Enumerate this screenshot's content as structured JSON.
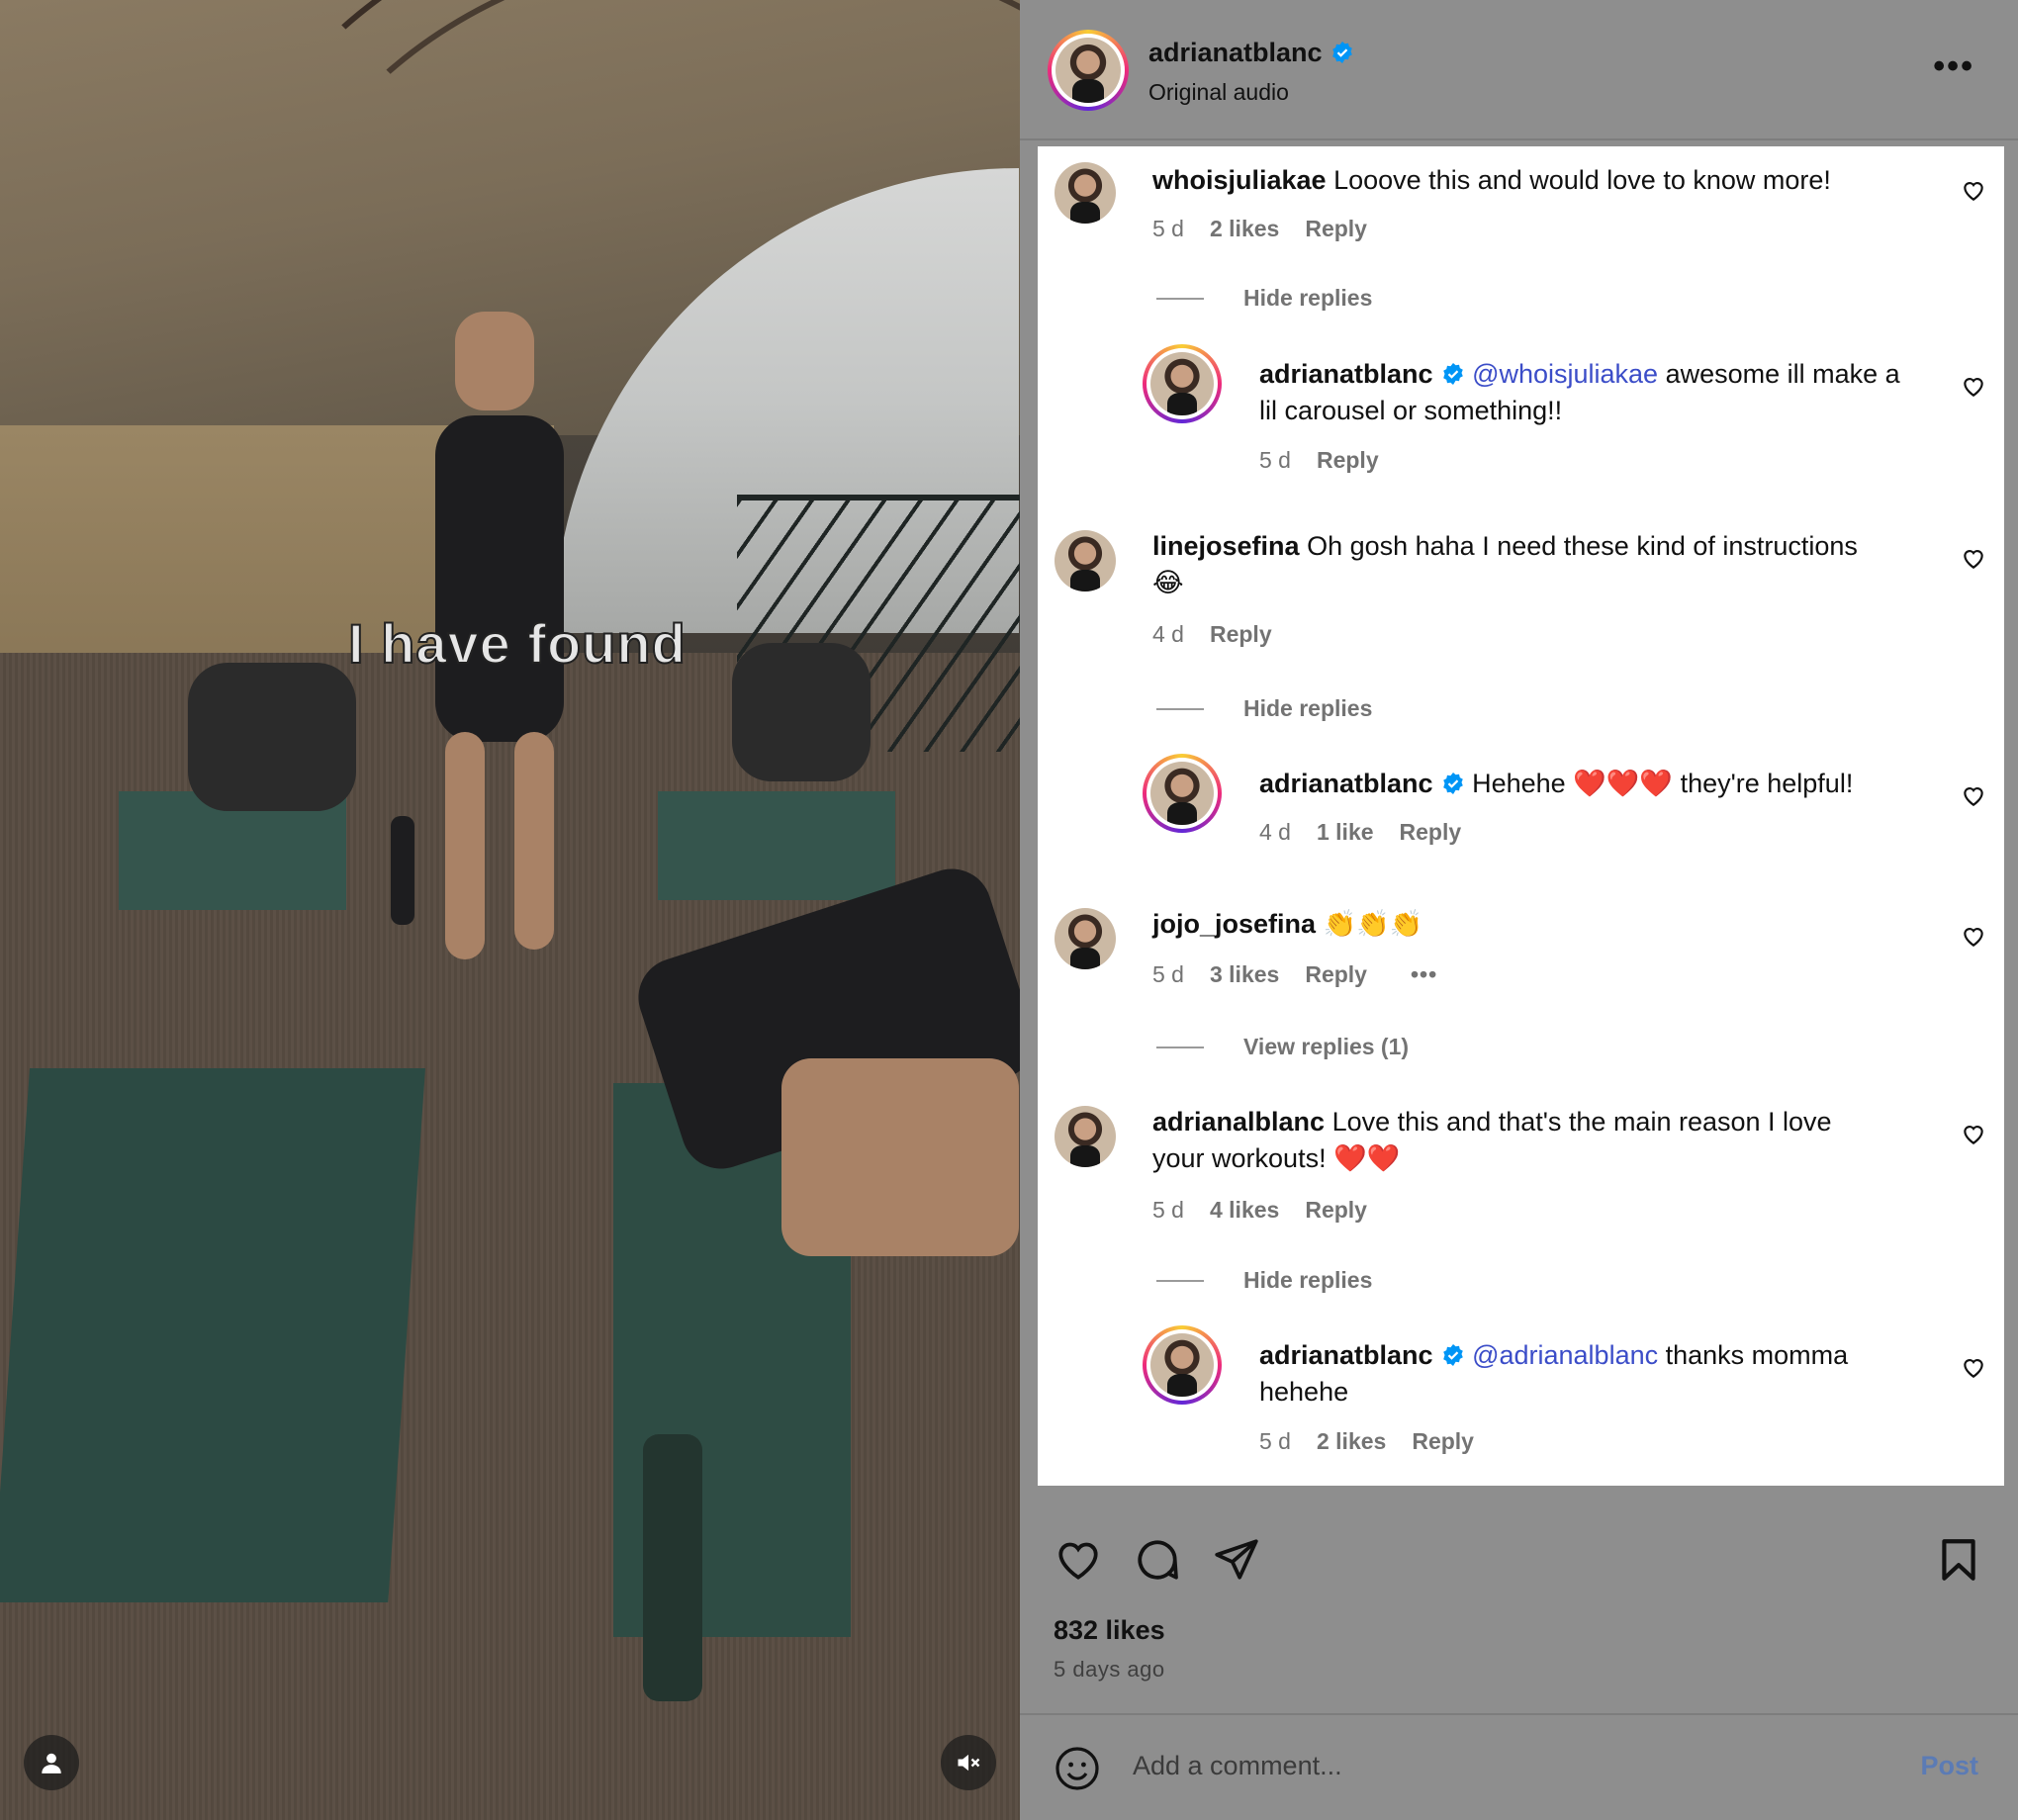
{
  "video": {
    "overlay_text": "I have found"
  },
  "header": {
    "username": "adrianatblanc",
    "subtitle": "Original audio"
  },
  "comments": [
    {
      "user": "whoisjuliakae",
      "text": "Looove this and would love to know more!",
      "time": "5 d",
      "likes": "2 likes",
      "reply": "Reply",
      "thread": "Hide replies",
      "replies": [
        {
          "user": "adrianatblanc",
          "mention": "@whoisjuliakae",
          "text": "awesome ill make a",
          "text2": "lil carousel or something!!",
          "time": "5 d",
          "reply": "Reply"
        }
      ]
    },
    {
      "user": "linejosefina",
      "text": "Oh gosh haha I need these kind of instructions",
      "emoji": "😂",
      "time": "4 d",
      "reply": "Reply",
      "thread": "Hide replies",
      "replies": [
        {
          "user": "adrianatblanc",
          "text": "Hehehe",
          "hearts": "❤️❤️❤️",
          "text_after": "they're helpful!",
          "time": "4 d",
          "likes": "1 like",
          "reply": "Reply"
        }
      ]
    },
    {
      "user": "jojo_josefina",
      "emoji": "👏👏👏",
      "time": "5 d",
      "likes": "3 likes",
      "reply": "Reply",
      "more": "•••",
      "thread": "View replies (1)"
    },
    {
      "user": "adrianalblanc",
      "text": "Love this and that's the main reason I love",
      "text2": "your workouts!",
      "hearts": "❤️❤️",
      "time": "5 d",
      "likes": "4 likes",
      "reply": "Reply",
      "thread": "Hide replies",
      "replies": [
        {
          "user": "adrianatblanc",
          "mention": "@adrianalblanc",
          "text": "thanks momma",
          "text2": "hehehe",
          "time": "5 d",
          "likes": "2 likes",
          "reply": "Reply"
        }
      ]
    }
  ],
  "footer": {
    "likes": "832 likes",
    "ago": "5 days ago",
    "placeholder": "Add a comment...",
    "post": "Post"
  },
  "colors": {
    "mention": "#3b4dc8",
    "verified": "#0095f6",
    "post": "#5b7bb5"
  }
}
